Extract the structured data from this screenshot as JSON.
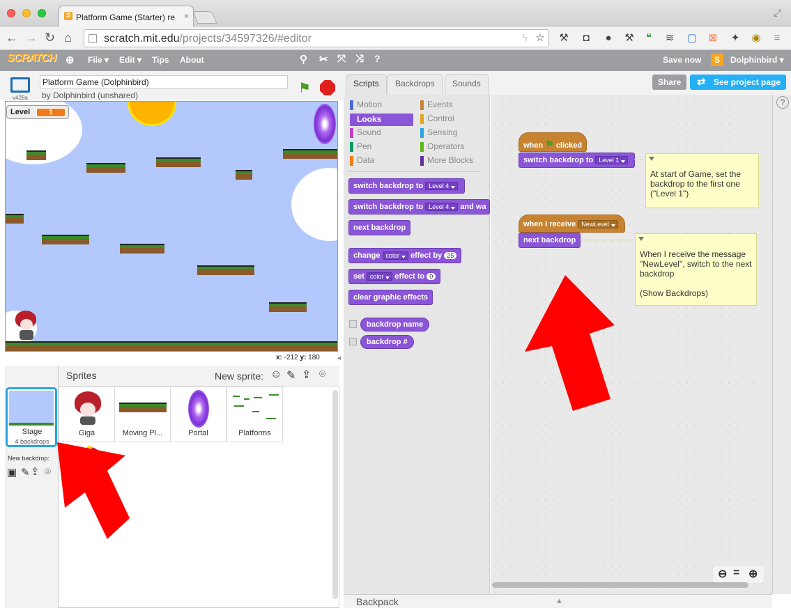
{
  "browser": {
    "tab_title": "Platform Game (Starter) re",
    "url_host": "scratch.mit.edu",
    "url_path": "/projects/34597326/#editor"
  },
  "menu": {
    "logo": "SCRATCH",
    "file": "File ▾",
    "edit": "Edit ▾",
    "tips": "Tips",
    "about": "About",
    "save_now": "Save now",
    "user": "Dolphinbird ▾"
  },
  "stage": {
    "version": "v428a",
    "project_title": "Platform Game (Dolphinbird)",
    "by_line": "by Dolphinbird (unshared)",
    "monitor_label": "Level",
    "monitor_value": "1",
    "x_label": "x:",
    "x_value": "-212",
    "y_label": "y:",
    "y_value": "180"
  },
  "sprites": {
    "header": "Sprites",
    "new_sprite": "New sprite:",
    "stage_label": "Stage",
    "stage_sub": "4 backdrops",
    "new_backdrop": "New backdrop:",
    "items": [
      "Giga",
      "Moving Pl...",
      "Portal",
      "Platforms"
    ]
  },
  "tabs": {
    "scripts": "Scripts",
    "backdrops": "Backdrops",
    "sounds": "Sounds"
  },
  "header_buttons": {
    "share": "Share",
    "see_project": "See project page"
  },
  "categories": {
    "motion": "Motion",
    "looks": "Looks",
    "sound": "Sound",
    "pen": "Pen",
    "data": "Data",
    "events": "Events",
    "control": "Control",
    "sensing": "Sensing",
    "operators": "Operators",
    "more": "More Blocks"
  },
  "palette": {
    "switch_backdrop_to": "switch backdrop to",
    "level4": "Level 4",
    "and_wait": "and wa",
    "next_backdrop": "next backdrop",
    "change": "change",
    "color": "color",
    "effect_by": "effect by",
    "n25": "25",
    "set": "set",
    "effect_to": "effect to",
    "n0": "0",
    "clear_effects": "clear graphic effects",
    "backdrop_name": "backdrop name",
    "backdrop_num": "backdrop #"
  },
  "script": {
    "when": "when",
    "clicked": "clicked",
    "switch_backdrop_to": "switch backdrop to",
    "level1": "Level 1",
    "when_i_receive": "when I receive",
    "newlevel": "NewLevel",
    "next_backdrop": "next backdrop",
    "comment1": "At start of Game, set the backdrop to the first one (\"Level 1\")",
    "comment2": "When I receive the message \"NewLevel\", switch to the next backdrop\n\n(Show Backdrops)"
  },
  "backpack": "Backpack",
  "colors": {
    "accent_looks": "#8a55d7",
    "events": "#c88330",
    "arrow": "#ff0000",
    "share_blue": "#25aff4"
  }
}
